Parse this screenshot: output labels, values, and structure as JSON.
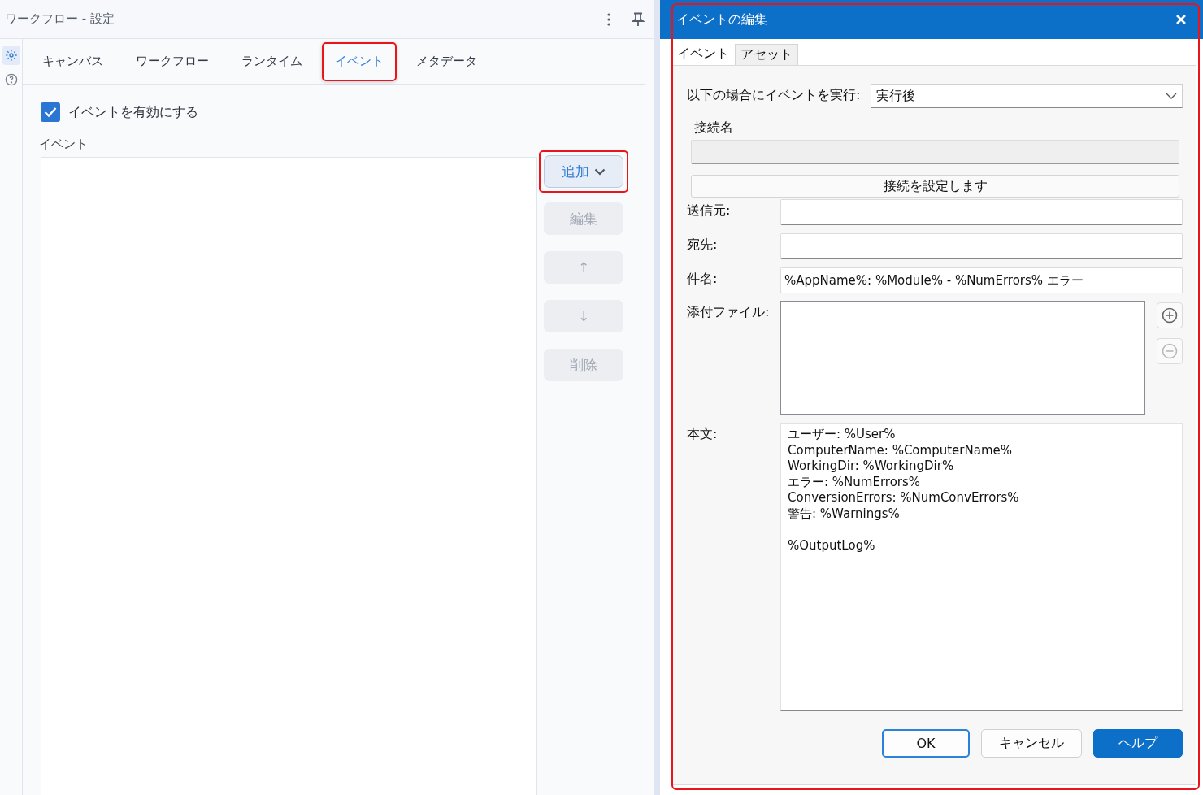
{
  "panel": {
    "title": "ワークフロー - 設定",
    "side_icons": [
      {
        "kind": "settings",
        "selected": true
      },
      {
        "kind": "help",
        "selected": false
      }
    ],
    "tabs": [
      {
        "label": "キャンバス",
        "selected": false,
        "highlighted": false
      },
      {
        "label": "ワークフロー",
        "selected": false,
        "highlighted": false
      },
      {
        "label": "ランタイム",
        "selected": false,
        "highlighted": false
      },
      {
        "label": "イベント",
        "selected": true,
        "highlighted": true
      },
      {
        "label": "メタデータ",
        "selected": false,
        "highlighted": false
      }
    ],
    "enable_checkbox": {
      "label": "イベントを有効にする",
      "checked": true
    },
    "events_label": "イベント",
    "buttons": [
      {
        "label": "追加",
        "kind": "dropdown",
        "disabled": false,
        "highlighted": true
      },
      {
        "label": "編集",
        "kind": "plain",
        "disabled": true,
        "highlighted": false
      },
      {
        "label": "↑",
        "kind": "plain",
        "disabled": true,
        "highlighted": false
      },
      {
        "label": "↓",
        "kind": "plain",
        "disabled": true,
        "highlighted": false
      },
      {
        "label": "削除",
        "kind": "plain",
        "disabled": true,
        "highlighted": false
      }
    ]
  },
  "dialog": {
    "title": "イベントの編集",
    "highlighted": true,
    "tabs": [
      {
        "label": "イベント",
        "selected": true
      },
      {
        "label": "アセット",
        "selected": false
      }
    ],
    "trigger": {
      "label": "以下の場合にイベントを実行:",
      "value": "実行後"
    },
    "connection": {
      "label": "接続名",
      "button": "接続を設定します"
    },
    "fields": [
      {
        "label": "送信元:"
      },
      {
        "label": "宛先:"
      },
      {
        "label": "件名:",
        "value": "%AppName%: %Module% - %NumErrors% エラー"
      }
    ],
    "attachments": {
      "label": "添付ファイル:",
      "add_disabled": false,
      "remove_disabled": true
    },
    "body": {
      "label": "本文:",
      "value": "ユーザー: %User%\nComputerName: %ComputerName%\nWorkingDir: %WorkingDir%\nエラー: %NumErrors%\nConversionErrors: %NumConvErrors%\n警告: %Warnings%\n\n%OutputLog%"
    },
    "buttons": [
      {
        "label": "OK",
        "kind": "default"
      },
      {
        "label": "キャンセル",
        "kind": "normal"
      },
      {
        "label": "ヘルプ",
        "kind": "primary"
      }
    ]
  }
}
